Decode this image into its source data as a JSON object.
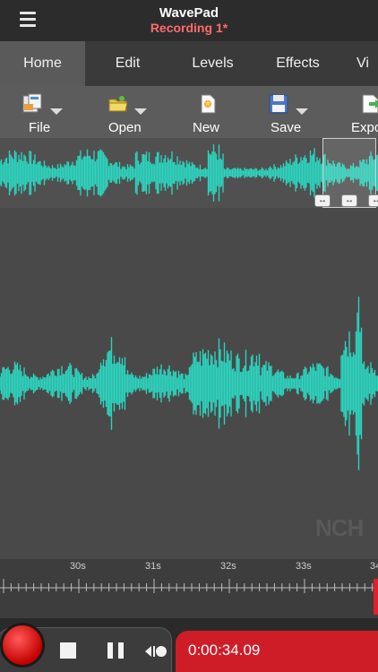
{
  "app": {
    "title": "WavePad",
    "document": "Recording 1*"
  },
  "tabs": [
    "Home",
    "Edit",
    "Levels",
    "Effects",
    "Vi"
  ],
  "toolbar": {
    "file": "File",
    "open": "Open",
    "new": "New",
    "save": "Save",
    "export": "Expo"
  },
  "timeline": {
    "labels": [
      "30s",
      "31s",
      "32s",
      "33s",
      "34"
    ]
  },
  "transport": {
    "time": "0:00:34.09"
  },
  "watermark": "NCH",
  "colors": {
    "waveform": "#2dd4bf",
    "accent_red": "#cf1d28",
    "title_red": "#ff6b6b"
  }
}
